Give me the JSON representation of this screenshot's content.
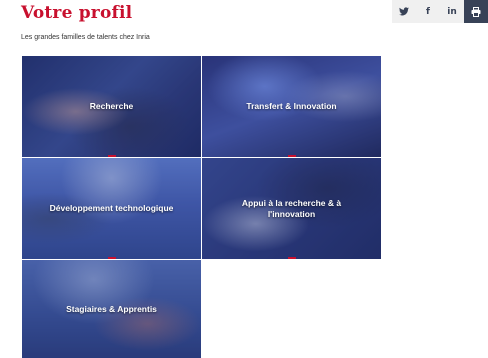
{
  "header": {
    "title": "Votre profil",
    "subtitle": "Les grandes familles de talents chez Inria"
  },
  "share": {
    "twitter": "twitter-icon",
    "facebook": "f",
    "linkedin": "in",
    "print": "print-icon"
  },
  "tiles": [
    {
      "label": "Recherche"
    },
    {
      "label": "Transfert & Innovation"
    },
    {
      "label": "Développement technologique"
    },
    {
      "label": "Appui à la recherche & à l'innovation"
    },
    {
      "label": "Stagiaires & Apprentis"
    }
  ],
  "colors": {
    "accent": "#c8102e",
    "share_dark": "#384257",
    "share_light": "#f0f0f0"
  }
}
